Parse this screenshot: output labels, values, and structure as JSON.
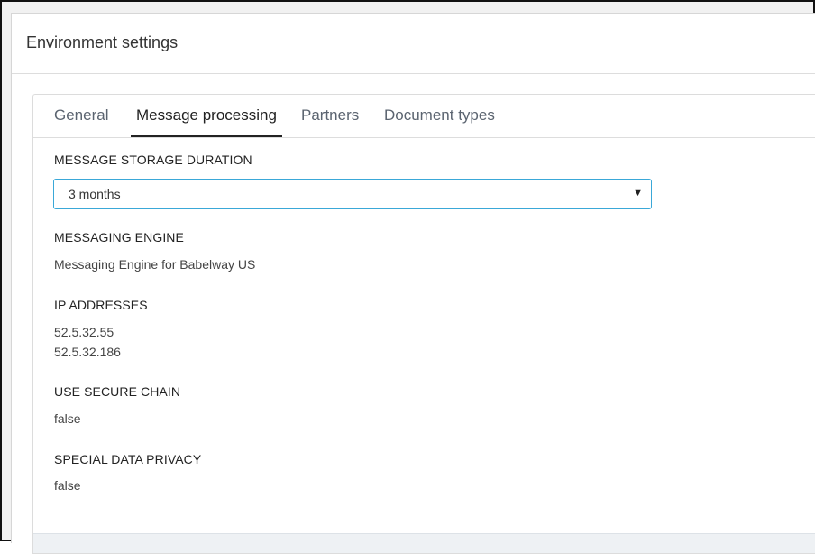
{
  "header": {
    "title": "Environment settings"
  },
  "tabs": [
    {
      "label": "General",
      "active": false
    },
    {
      "label": "Message processing",
      "active": true
    },
    {
      "label": "Partners",
      "active": false
    },
    {
      "label": "Document types",
      "active": false
    }
  ],
  "message_storage": {
    "label": "MESSAGE STORAGE DURATION",
    "selected": "3 months"
  },
  "messaging_engine": {
    "label": "MESSAGING ENGINE",
    "value": "Messaging Engine for Babelway US"
  },
  "ip_addresses": {
    "label": "IP ADDRESSES",
    "values": [
      "52.5.32.55",
      "52.5.32.186"
    ]
  },
  "secure_chain": {
    "label": "USE SECURE CHAIN",
    "value": "false"
  },
  "data_privacy": {
    "label": "SPECIAL DATA PRIVACY",
    "value": "false"
  },
  "colors": {
    "select_border": "#3aa8d8",
    "active_tab_underline": "#222222",
    "footer_bg": "#eef1f4"
  }
}
